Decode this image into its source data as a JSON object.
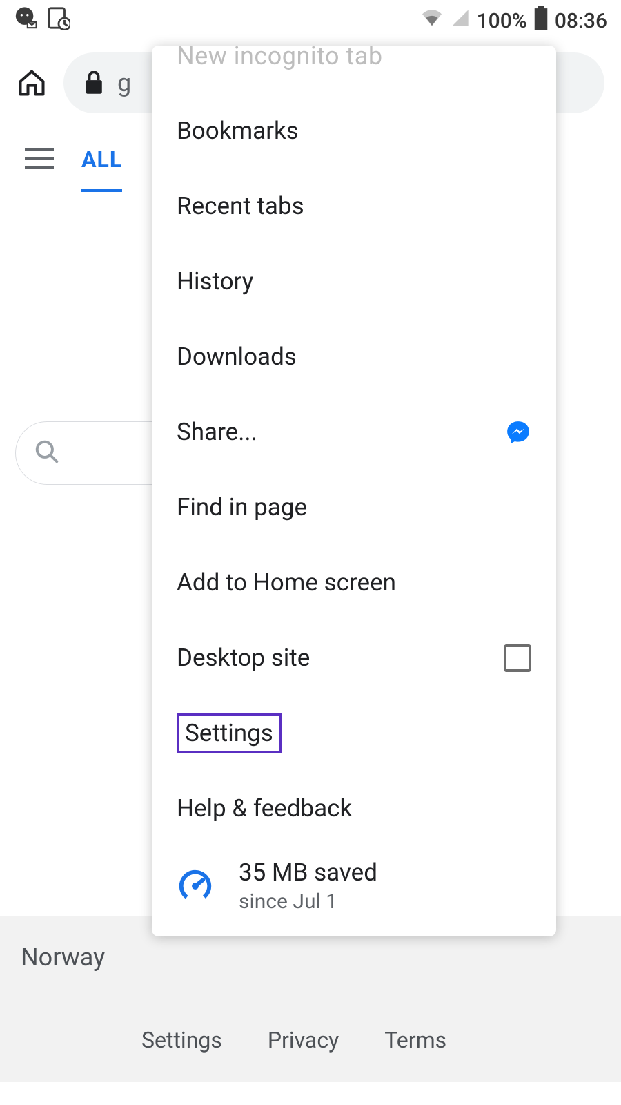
{
  "status": {
    "battery_percent": "100%",
    "time": "08:36"
  },
  "toolbar": {
    "url_fragment": "g"
  },
  "tabs": {
    "all_label": "ALL"
  },
  "location": "Norway",
  "footer": {
    "settings": "Settings",
    "privacy": "Privacy",
    "terms": "Terms"
  },
  "menu": {
    "new_incognito": "New incognito tab",
    "bookmarks": "Bookmarks",
    "recent_tabs": "Recent tabs",
    "history": "History",
    "downloads": "Downloads",
    "share": "Share...",
    "find_in_page": "Find in page",
    "add_home": "Add to Home screen",
    "desktop_site": "Desktop site",
    "settings": "Settings",
    "help": "Help & feedback",
    "data_saved": "35 MB saved",
    "data_since": "since Jul 1"
  }
}
